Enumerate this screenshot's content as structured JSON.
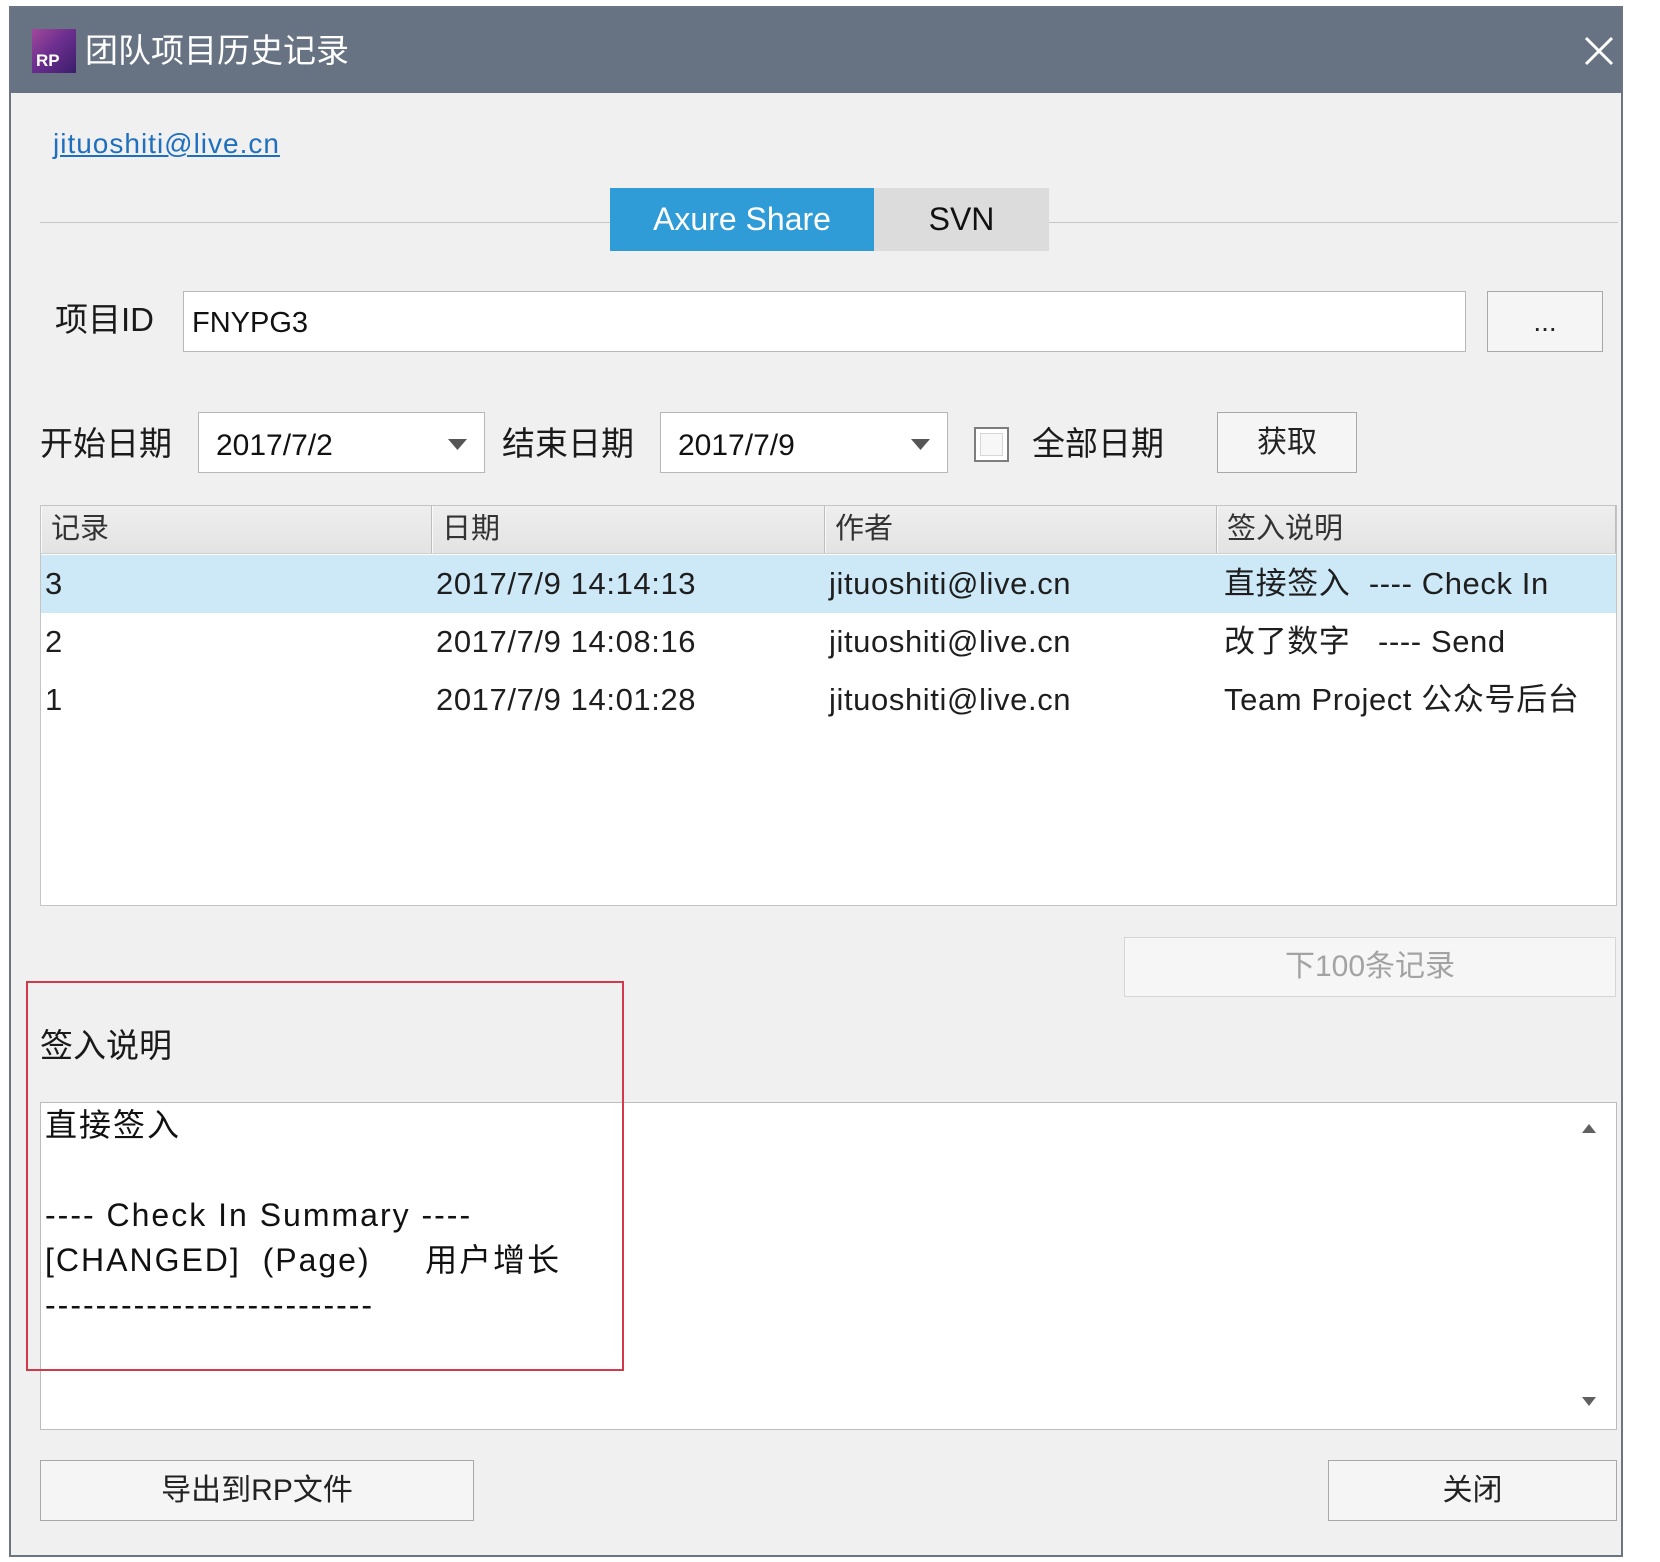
{
  "window": {
    "title": "团队项目历史记录",
    "app_icon": "RP"
  },
  "account": {
    "email": "jituoshiti@live.cn"
  },
  "tabs": [
    {
      "label": "Axure Share",
      "active": true
    },
    {
      "label": "SVN",
      "active": false
    }
  ],
  "project": {
    "label": "项目ID",
    "value": "FNYPG3",
    "browse_label": "..."
  },
  "filters": {
    "start_label": "开始日期",
    "start_value": "2017/7/2",
    "end_label": "结束日期",
    "end_value": "2017/7/9",
    "all_dates_label": "全部日期",
    "all_dates_checked": false,
    "fetch_label": "获取"
  },
  "table": {
    "columns": [
      "记录",
      "日期",
      "作者",
      "签入说明"
    ],
    "rows": [
      {
        "record": "3",
        "date": "2017/7/9 14:14:13",
        "author": "jituoshiti@live.cn",
        "note": "直接签入  ---- Check In",
        "selected": true
      },
      {
        "record": "2",
        "date": "2017/7/9 14:08:16",
        "author": "jituoshiti@live.cn",
        "note": "改了数字   ---- Send",
        "selected": false
      },
      {
        "record": "1",
        "date": "2017/7/9 14:01:28",
        "author": "jituoshiti@live.cn",
        "note": "Team Project 公众号后台",
        "selected": false
      }
    ],
    "next_label": "下100条记录",
    "next_enabled": false
  },
  "checkin": {
    "label": "签入说明",
    "lines": [
      "直接签入",
      "",
      "---- Check In Summary ----",
      "[CHANGED]  (Page)     用户增长",
      "--------------------------"
    ]
  },
  "footer": {
    "export_label": "导出到RP文件",
    "close_label": "关闭"
  },
  "icons": {
    "app": "axure-rp-app-icon",
    "close": "close-icon",
    "dropdown": "dropdown-arrow-icon",
    "checkbox": "checkbox-icon",
    "scroll_up": "scroll-up-arrow-icon",
    "scroll_down": "scroll-down-arrow-icon"
  },
  "colors": {
    "title_bar": "#677283",
    "accent": "#2f9bd7",
    "selected_row": "#cde8f7",
    "link": "#1f6fbf",
    "annotation": "#d23a4c"
  }
}
